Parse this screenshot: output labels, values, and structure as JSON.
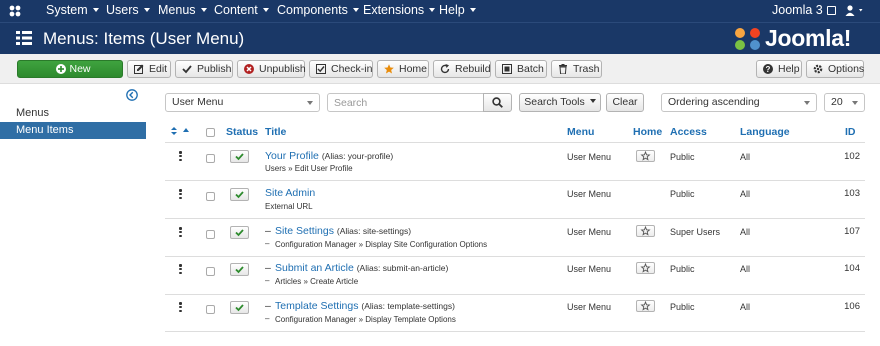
{
  "topnav": {
    "items": [
      "System",
      "Users",
      "Menus",
      "Content",
      "Components",
      "Extensions",
      "Help"
    ],
    "site_link": "Joomla 3",
    "user_icon": "user-icon"
  },
  "header": {
    "title": "Menus: Items (User Menu)",
    "brand": "Joomla!"
  },
  "toolbar": {
    "new": "New",
    "edit": "Edit",
    "publish": "Publish",
    "unpublish": "Unpublish",
    "checkin": "Check-in",
    "home": "Home",
    "rebuild": "Rebuild",
    "batch": "Batch",
    "trash": "Trash",
    "help": "Help",
    "options": "Options"
  },
  "sidebar": {
    "items": [
      {
        "label": "Menus",
        "active": false
      },
      {
        "label": "Menu Items",
        "active": true
      }
    ]
  },
  "filters": {
    "menu_select": "User Menu",
    "search_placeholder": "Search",
    "search_tools": "Search Tools",
    "clear": "Clear",
    "ordering": "Ordering ascending",
    "limit": "20"
  },
  "table": {
    "headers": {
      "status": "Status",
      "title": "Title",
      "menu": "Menu",
      "home": "Home",
      "access": "Access",
      "language": "Language",
      "id": "ID"
    },
    "rows": [
      {
        "prefix": "",
        "title": "Your Profile",
        "alias": "(Alias: your-profile)",
        "sub": "Users » Edit User Profile",
        "menu": "User Menu",
        "home": true,
        "access": "Public",
        "language": "All",
        "id": "102"
      },
      {
        "prefix": "",
        "title": "Site Admin",
        "alias": "",
        "sub": "External URL",
        "menu": "User Menu",
        "home": false,
        "access": "Public",
        "language": "All",
        "id": "103"
      },
      {
        "prefix": "–",
        "title": "Site Settings",
        "alias": "(Alias: site-settings)",
        "sub": "Configuration Manager » Display Site Configuration Options",
        "menu": "User Menu",
        "home": true,
        "access": "Super Users",
        "language": "All",
        "id": "107"
      },
      {
        "prefix": "–",
        "title": "Submit an Article",
        "alias": "(Alias: submit-an-article)",
        "sub": "Articles » Create Article",
        "menu": "User Menu",
        "home": true,
        "access": "Public",
        "language": "All",
        "id": "104"
      },
      {
        "prefix": "–",
        "title": "Template Settings",
        "alias": "(Alias: template-settings)",
        "sub": "Configuration Manager » Display Template Options",
        "menu": "User Menu",
        "home": true,
        "access": "Public",
        "language": "All",
        "id": "106"
      }
    ]
  },
  "colors": {
    "navbar": "#1a3867",
    "accent": "#2f6ea5",
    "link": "#1f6fb2",
    "new_button": "#339933",
    "check": "#2e8b2e"
  }
}
